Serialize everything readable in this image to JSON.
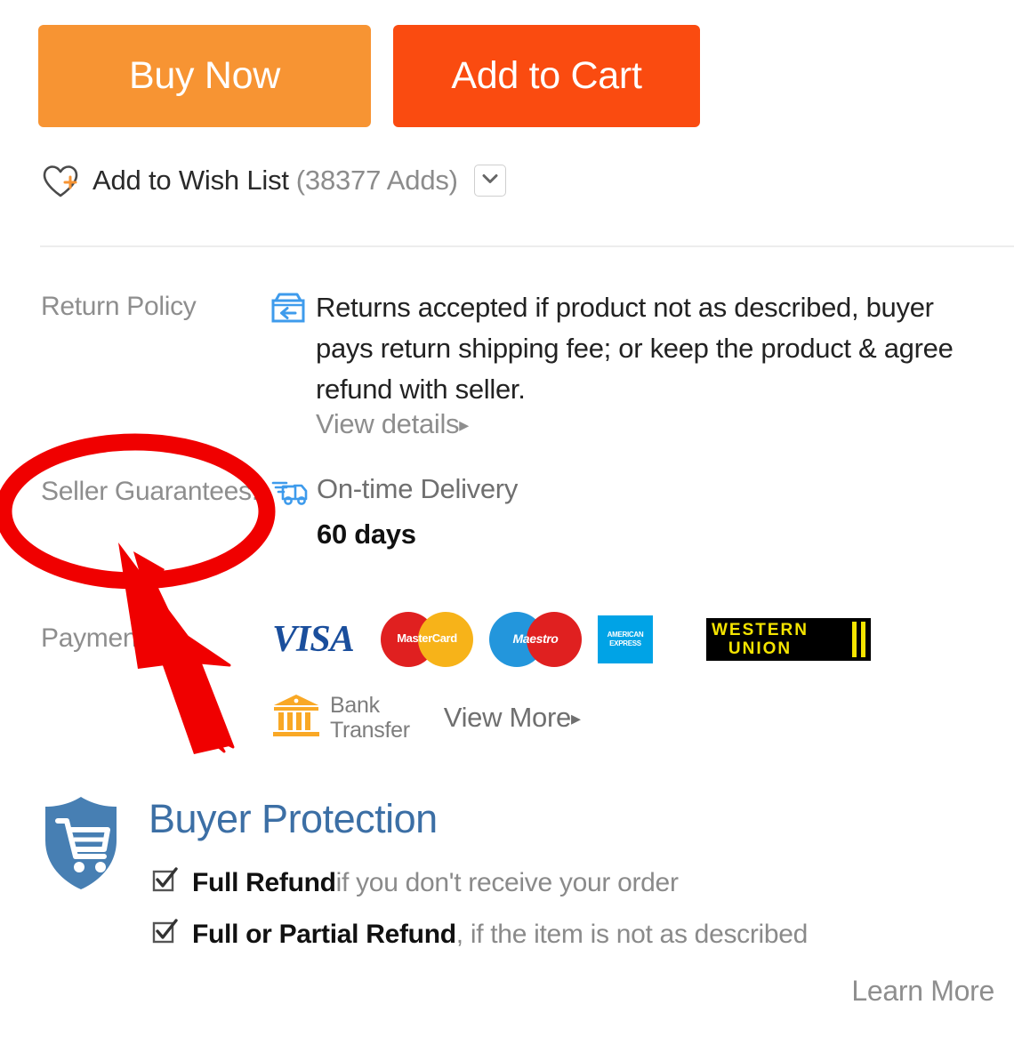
{
  "actions": {
    "buy_now_label": "Buy Now",
    "add_to_cart_label": "Add to Cart",
    "buy_now_color": "#F79433",
    "add_to_cart_color": "#FA4B10"
  },
  "wishlist": {
    "icon": "heart-plus-icon",
    "label": "Add to Wish List",
    "count_text": "(38377 Adds)",
    "dropdown_icon": "chevron-down-icon"
  },
  "return_policy": {
    "label": "Return Policy",
    "icon": "return-box-icon",
    "text": "Returns accepted if product not as described, buyer pays return shipping fee; or keep the product & agree refund with seller.",
    "view_details_label": "View details",
    "view_details_arrow": "▸"
  },
  "seller_guarantees": {
    "label": "Seller Guarantees:",
    "icon": "delivery-truck-icon",
    "delivery_title": "On-time Delivery",
    "delivery_days": "60 days"
  },
  "payment": {
    "label": "Paymen",
    "methods": [
      {
        "name": "visa-logo",
        "text": "VISA"
      },
      {
        "name": "mastercard-logo",
        "text": "MasterCard"
      },
      {
        "name": "maestro-logo",
        "text": "Maestro"
      },
      {
        "name": "american-express-logo",
        "line1": "AMERICAN",
        "line2": "EXPRESS"
      },
      {
        "name": "western-union-logo",
        "line1": "WESTERN",
        "line2": "UNION"
      }
    ],
    "bank_transfer": {
      "icon": "bank-icon",
      "line1": "Bank",
      "line2": "Transfer"
    },
    "view_more_label": "View More",
    "view_more_arrow": "▸"
  },
  "buyer_protection": {
    "icon": "shield-cart-icon",
    "title": "Buyer Protection",
    "items": [
      {
        "icon": "checkbox-checked-icon",
        "strong": "Full Refund",
        "rest": " if you don't receive your order"
      },
      {
        "icon": "checkbox-checked-icon",
        "strong": "Full or Partial Refund",
        "rest": " , if the item is not as described"
      }
    ],
    "learn_more_label": "Learn More"
  },
  "annotation": {
    "color": "#F00000",
    "ellipse_name": "red-highlight-ellipse",
    "arrow_name": "red-pointer-arrow"
  }
}
